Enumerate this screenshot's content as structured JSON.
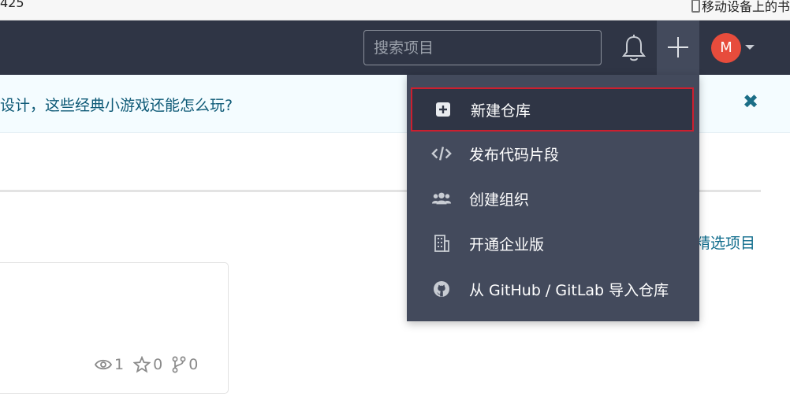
{
  "browser": {
    "left_text": "425",
    "right_text": "移动设备上的书"
  },
  "navbar": {
    "search_placeholder": "搜索项目",
    "avatar_letter": "M"
  },
  "announcement": {
    "text": "设计，这些经典小游戏还能怎么玩?"
  },
  "main": {
    "featured_link": "精选项目",
    "card_stats": {
      "watch": "1",
      "star": "0",
      "fork": "0"
    }
  },
  "dropdown": {
    "items": [
      {
        "label": "新建仓库",
        "icon": "plus-square-icon"
      },
      {
        "label": "发布代码片段",
        "icon": "code-icon"
      },
      {
        "label": "创建组织",
        "icon": "users-icon"
      },
      {
        "label": "开通企业版",
        "icon": "building-icon"
      },
      {
        "label": "从 GitHub / GitLab 导入仓库",
        "icon": "github-icon"
      }
    ]
  },
  "colors": {
    "navbar_bg": "#2f3545",
    "dropdown_bg": "#434a5c",
    "avatar_bg": "#e74c3c",
    "highlight_border": "#cc1f2f",
    "link": "#0f6c8c"
  }
}
